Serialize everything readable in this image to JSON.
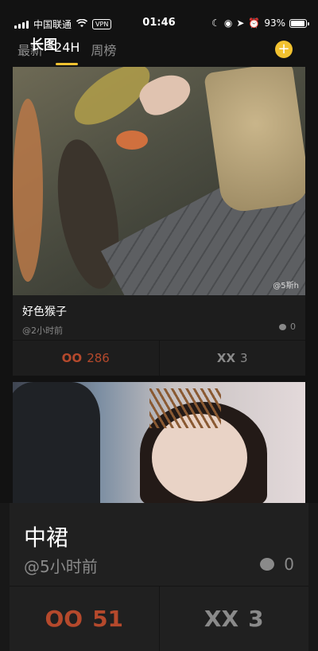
{
  "status_bar": {
    "carrier": "中国联通",
    "vpn": "VPN",
    "time": "01:46",
    "battery_text": "93%",
    "battery_level": 0.93
  },
  "overlay_badge": "长图",
  "tabs": [
    {
      "label": "最新",
      "active": false
    },
    {
      "label": "24H",
      "active": true
    },
    {
      "label": "周榜",
      "active": false
    }
  ],
  "add_button": "+",
  "posts": [
    {
      "title": "好色猴子",
      "time": "@2小时前",
      "comments": "0",
      "watermark": "@5斯h",
      "up_label": "OO",
      "up_count": "286",
      "down_label": "XX",
      "down_count": "3"
    },
    {
      "title": "中裙",
      "time": "@5小时前",
      "comments": "0",
      "up_label": "OO",
      "up_count": "51",
      "down_label": "XX",
      "down_count": "3"
    }
  ],
  "colors": {
    "accent": "#f2c230",
    "vote_up": "#b5492c",
    "vote_down": "#8a8a8a",
    "background": "#121212"
  }
}
